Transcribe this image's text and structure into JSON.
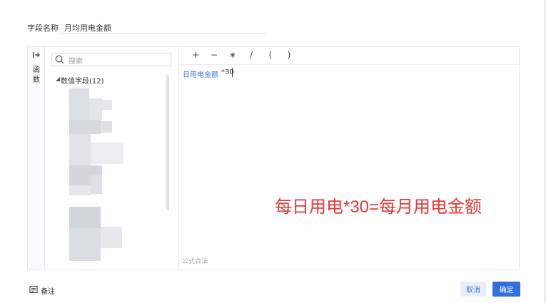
{
  "field": {
    "label": "字段名称",
    "value": "月均用电金额"
  },
  "side_tab": {
    "label_line1": "函",
    "label_line2": "数"
  },
  "search": {
    "placeholder": "搜索"
  },
  "tree": {
    "toggle": "◢",
    "group_label": "数值字段(12)"
  },
  "toolbar": {
    "ops": [
      "+",
      "−",
      "∗",
      "/",
      "(",
      ")"
    ]
  },
  "formula": {
    "field": "日用电金额",
    "operator": "*30"
  },
  "annotation": "每日用电*30=每月用电金额",
  "hint": "公式合法",
  "footer": {
    "note_label": "备注",
    "cancel_label": "取消",
    "ok_label": "确定"
  },
  "colors": {
    "accent": "#2f6fe0",
    "field_token": "#3b79e6",
    "annotation": "#e53935"
  }
}
